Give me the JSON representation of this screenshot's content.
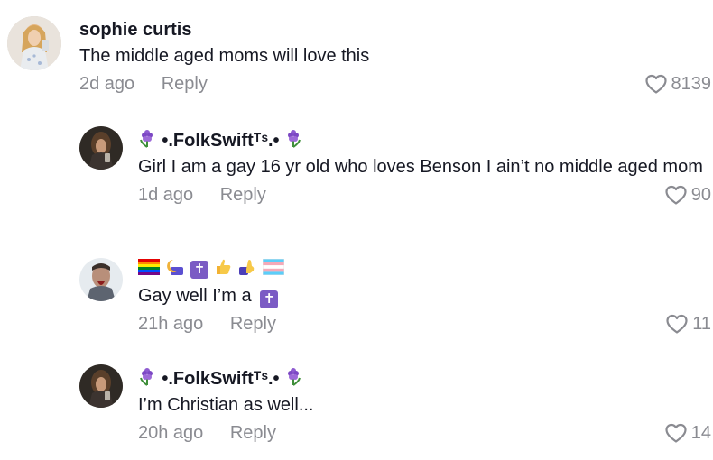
{
  "comments": [
    {
      "username": "sophie curtis",
      "text": "The middle aged moms will love this",
      "date": "2d ago",
      "reply": "Reply",
      "likes": "8139"
    },
    {
      "username": "•.FolkSwiftᵀˢ.•",
      "text": "Girl I am a gay 16 yr old who loves Benson I ain’t no middle aged mom",
      "date": "1d ago",
      "reply": "Reply",
      "likes": "90"
    },
    {
      "username_icons": [
        "rainbow-flag-icon",
        "crescent-icon",
        "latin-cross-icon",
        "thumbs-up-icon",
        "pointing-hand-icon",
        "transgender-flag-icon"
      ],
      "text": "Gay well I’m a",
      "text_icon": "latin-cross-icon",
      "date": "21h ago",
      "reply": "Reply",
      "likes": "11"
    },
    {
      "username": "•.FolkSwiftᵀˢ.•",
      "text": "I’m Christian as well...",
      "date": "20h ago",
      "reply": "Reply",
      "likes": "14"
    }
  ],
  "icons": {
    "flower": "hyacinth-icon",
    "like": "heart-outline-icon"
  },
  "colors": {
    "text": "#161823",
    "secondary": "#8a8b91",
    "cross_tile": "#7b5bc4"
  },
  "glyphs": {
    "crescent": "☾",
    "cross": "✝",
    "thumbs_up": "👍",
    "pointing": "👉"
  }
}
